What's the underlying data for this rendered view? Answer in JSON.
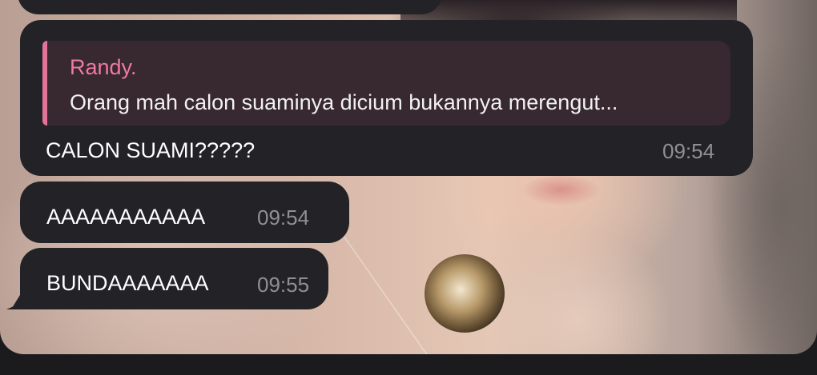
{
  "chat": {
    "messages": [
      {
        "reply_to": {
          "sender": "Randy.",
          "text": "Orang mah calon suaminya dicium bukannya merengut..."
        },
        "text": "CALON SUAMI?????",
        "time": "09:54"
      },
      {
        "text": "AAAAAAAAAAA",
        "time": "09:54"
      },
      {
        "text": "BUNDAAAAAAA",
        "time": "09:55"
      }
    ]
  },
  "colors": {
    "bubble": "#232327",
    "quote_accent": "#e27497",
    "quote_background": "#38282f",
    "timestamp": "#8f8f97"
  }
}
